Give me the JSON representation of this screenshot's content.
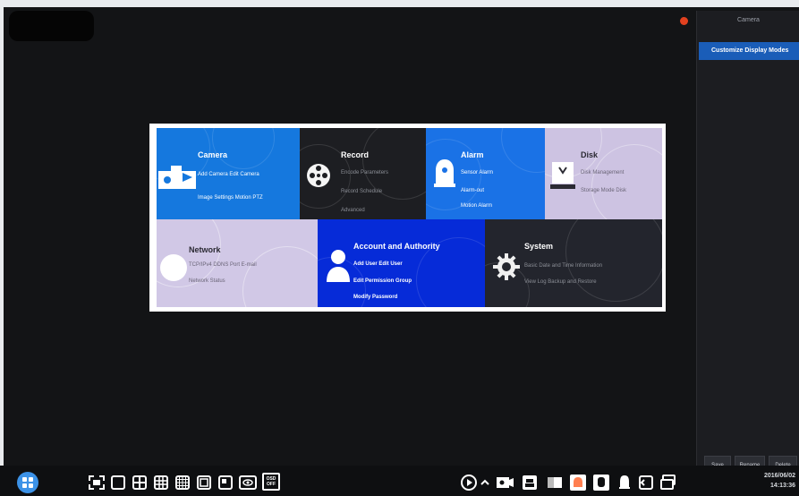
{
  "right_panel": {
    "title": "Camera",
    "items": [
      "Customize Display Modes"
    ],
    "buttons": [
      "Save",
      "Rename",
      "Delete"
    ]
  },
  "menu": {
    "camera": {
      "title": "Camera",
      "lines": [
        "Add Camera  Edit Camera",
        "Image Settings  Motion  PTZ"
      ],
      "icon": "camera-icon"
    },
    "record": {
      "title": "Record",
      "lines": [
        "Encode Parameters",
        "Record Schedule",
        "Advanced"
      ],
      "icon": "film-reel-icon"
    },
    "alarm": {
      "title": "Alarm",
      "lines": [
        "Sensor Alarm",
        "Alarm-out",
        "Motion Alarm"
      ],
      "icon": "alarm-bell-icon"
    },
    "disk": {
      "title": "Disk",
      "lines": [
        "Disk Management",
        "Storage Mode  Disk"
      ],
      "icon": "disk-icon"
    },
    "network": {
      "title": "Network",
      "lines": [
        "TCP/IPv4  DDNS  Port  E-mail",
        "Network Status"
      ],
      "icon": "network-icon"
    },
    "account": {
      "title": "Account and Authority",
      "lines": [
        "Add User  Edit User",
        "Edit Permission Group",
        "Modify Password"
      ],
      "icon": "user-icon"
    },
    "system": {
      "title": "System",
      "lines": [
        "Basic  Date and Time  Information",
        "View Log  Backup and Restore"
      ],
      "icon": "gear-icon"
    }
  },
  "taskbar": {
    "left_icons": [
      "start-menu-icon",
      "fullscreen-icon",
      "single-screen-icon",
      "quad-screen-icon",
      "nine-screen-icon",
      "sixteen-screen-icon",
      "custom-layout-icon",
      "eye-icon",
      "osd-off-icon"
    ],
    "right_icons": [
      "play-icon",
      "chevron-up-icon",
      "camera-control-icon",
      "lock-icon",
      "bookmark-icon",
      "alarm-bell-icon",
      "notification-icon",
      "back-icon",
      "window-switch-icon"
    ],
    "osd_label": "OSD",
    "osd_state": "OFF",
    "date": "2016/06/02",
    "time": "14:13:36"
  },
  "colors": {
    "screen_bg": "#131416",
    "accent_blue": "#1578de",
    "account_blue": "#062bd8",
    "selected_item": "#1a5db8",
    "record_tile": "#1d1e22",
    "disk_tile": "#cdc3e2",
    "network_tile": "#d1c8e6",
    "system_tile": "#23252d"
  }
}
